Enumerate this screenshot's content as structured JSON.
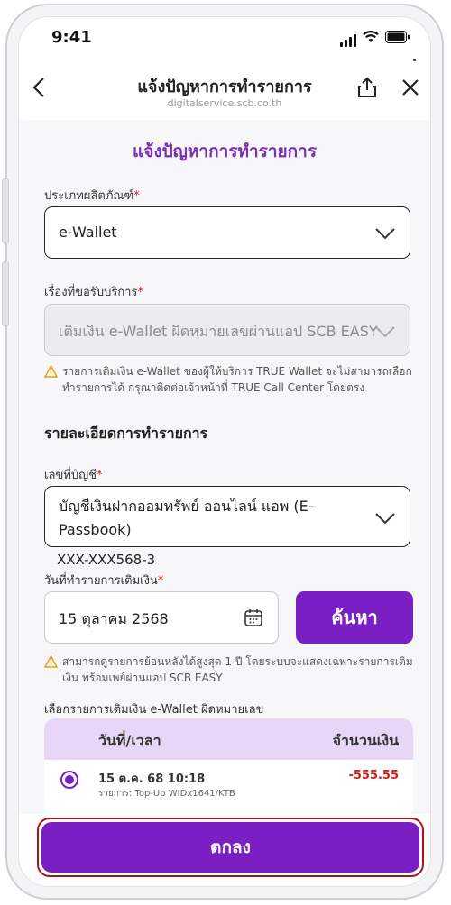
{
  "status_bar": {
    "time": "9:41"
  },
  "nav": {
    "title": "แจ้งปัญหาการทำรายการ",
    "url": "digitalservice.scb.co.th"
  },
  "page": {
    "title": "แจ้งปัญหาการทำรายการ"
  },
  "form": {
    "product_type": {
      "label": "ประเภทผลิตภัณฑ์",
      "value": "e-Wallet"
    },
    "service_topic": {
      "label": "เรื่องที่ขอรับบริการ",
      "value": "เติมเงิน e-Wallet ผิดหมายเลขผ่านแอป SCB EASY",
      "warning": "รายการเติมเงิน e-Wallet ของผู้ให้บริการ TRUE Wallet จะไม่สามารถเลือกทำรายการได้ กรุณาติดต่อเจ้าหน้าที่ TRUE Call Center โดยตรง"
    },
    "section_heading": "รายละเอียดการทำรายการ",
    "account": {
      "label": "เลขที่บัญชี",
      "value_line1": "บัญชีเงินฝากออมทรัพย์ ออนไลน์ แอพ (E-",
      "value_line2": "Passbook)",
      "number": "XXX-XXX568-3"
    },
    "topup_date": {
      "label": "วันที่ทำรายการเติมเงิน",
      "value": "15 ตุลาคม 2568",
      "search_label": "ค้นหา",
      "warning": "สามารถดูรายการย้อนหลังได้สูงสุด 1 ปี โดยระบบจะแสดงเฉพาะรายการเติมเงิน พร้อมเพย์ผ่านแอป SCB EASY"
    },
    "transactions": {
      "label": "เลือกรายการเติมเงิน e-Wallet ผิดหมายเลข",
      "col_datetime": "วันที่/เวลา",
      "col_amount": "จำนวนเงิน",
      "rows": [
        {
          "datetime": "15 ต.ค. 68 10:18",
          "desc": "รายการ: Top-Up WIDx1641/KTB",
          "amount": "-555.55"
        }
      ]
    }
  },
  "confirm_label": "ตกลง",
  "required_mark": "*",
  "colors": {
    "accent": "#7a1fc4",
    "title_purple": "#7a2fb8",
    "negative": "#d91c1c"
  }
}
